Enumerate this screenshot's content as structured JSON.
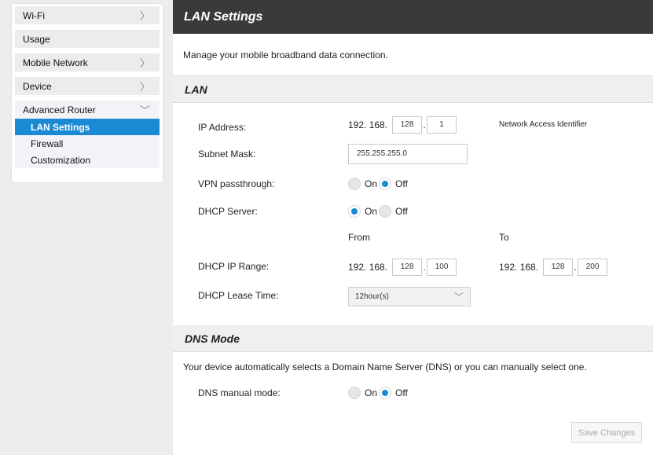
{
  "sidebar": {
    "items": [
      {
        "label": "Wi-Fi"
      },
      {
        "label": "Usage"
      },
      {
        "label": "Mobile Network"
      },
      {
        "label": "Device"
      }
    ],
    "group": {
      "label": "Advanced Router",
      "subitems": [
        {
          "label": "LAN Settings"
        },
        {
          "label": "Firewall"
        },
        {
          "label": "Customization"
        }
      ]
    }
  },
  "page": {
    "title": "LAN Settings",
    "intro": "Manage your mobile broadband data connection."
  },
  "lan": {
    "section_title": "LAN",
    "ip_address": {
      "label": "IP Address:",
      "prefix": "192. 168.",
      "octet3": "128",
      "octet4": "1",
      "note": "Network Access Identifier"
    },
    "subnet_mask": {
      "label": "Subnet Mask:",
      "value": "255.255.255.0"
    },
    "vpn": {
      "label": "VPN passthrough:",
      "on": "On",
      "off": "Off",
      "selected": "Off"
    },
    "dhcp_server": {
      "label": "DHCP Server:",
      "on": "On",
      "off": "Off",
      "selected": "On"
    },
    "range_headers": {
      "from": "From",
      "to": "To"
    },
    "dhcp_range": {
      "label": "DHCP IP Range:",
      "from_prefix": "192. 168.",
      "from_octet3": "128",
      "from_octet4": "100",
      "to_prefix": "192. 168.",
      "to_octet3": "128",
      "to_octet4": "200"
    },
    "lease": {
      "label": "DHCP Lease Time:",
      "value": "12hour(s)"
    }
  },
  "dns": {
    "section_title": "DNS Mode",
    "description": "Your device automatically selects a Domain Name Server (DNS) or you can manually select one.",
    "manual": {
      "label": "DNS manual mode:",
      "on": "On",
      "off": "Off",
      "selected": "Off"
    }
  },
  "actions": {
    "save_label": "Save Changes"
  },
  "colors": {
    "accent": "#1a8ad4",
    "titlebar": "#3a3a3a"
  }
}
